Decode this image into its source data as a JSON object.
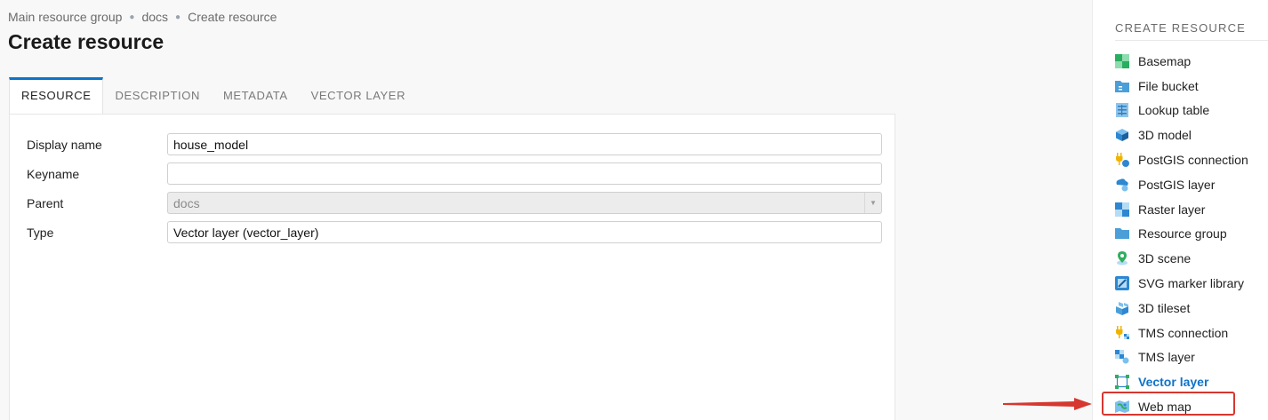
{
  "breadcrumb": [
    {
      "label": "Main resource group"
    },
    {
      "label": "docs"
    },
    {
      "label": "Create resource"
    }
  ],
  "page_title": "Create resource",
  "tabs": [
    {
      "label": "RESOURCE",
      "active": true
    },
    {
      "label": "DESCRIPTION",
      "active": false
    },
    {
      "label": "METADATA",
      "active": false
    },
    {
      "label": "VECTOR LAYER",
      "active": false
    }
  ],
  "form": {
    "display_name": {
      "label": "Display name",
      "value": "house_model"
    },
    "keyname": {
      "label": "Keyname",
      "value": ""
    },
    "parent": {
      "label": "Parent",
      "value": "docs"
    },
    "type": {
      "label": "Type",
      "value": "Vector layer (vector_layer)"
    }
  },
  "sidebar": {
    "title": "CREATE RESOURCE",
    "items": [
      {
        "label": "Basemap",
        "icon": "basemap-icon"
      },
      {
        "label": "File bucket",
        "icon": "file-bucket-icon"
      },
      {
        "label": "Lookup table",
        "icon": "lookup-table-icon"
      },
      {
        "label": "3D model",
        "icon": "3d-model-icon"
      },
      {
        "label": "PostGIS connection",
        "icon": "postgis-connection-icon"
      },
      {
        "label": "PostGIS layer",
        "icon": "postgis-layer-icon"
      },
      {
        "label": "Raster layer",
        "icon": "raster-layer-icon"
      },
      {
        "label": "Resource group",
        "icon": "folder-icon"
      },
      {
        "label": "3D scene",
        "icon": "3d-scene-icon"
      },
      {
        "label": "SVG marker library",
        "icon": "svg-marker-library-icon"
      },
      {
        "label": "3D tileset",
        "icon": "3d-tileset-icon"
      },
      {
        "label": "TMS connection",
        "icon": "tms-connection-icon"
      },
      {
        "label": "TMS layer",
        "icon": "tms-layer-icon"
      },
      {
        "label": "Vector layer",
        "icon": "vector-layer-icon",
        "active": true
      },
      {
        "label": "Web map",
        "icon": "web-map-icon",
        "highlighted": true
      }
    ]
  },
  "colors": {
    "accent": "#0f73c8",
    "highlight": "#d6372f"
  }
}
